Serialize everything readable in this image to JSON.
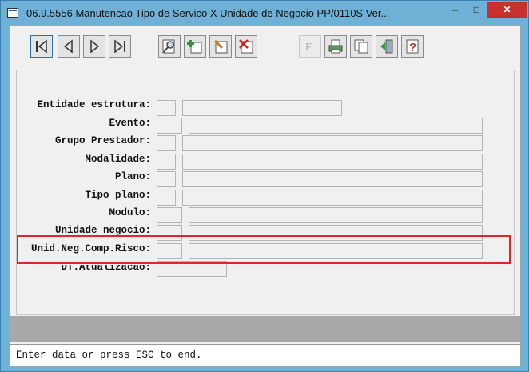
{
  "window": {
    "title": "06.9.5556 Manutencao  Tipo de Servico X Unidade de Negocio PP/0110S Ver..."
  },
  "toolbar": {
    "buttons": [
      {
        "name": "first-record-button",
        "icon": "first-record-icon"
      },
      {
        "name": "previous-record-button",
        "icon": "previous-record-icon"
      },
      {
        "name": "next-record-button",
        "icon": "next-record-icon"
      },
      {
        "name": "last-record-button",
        "icon": "last-record-icon"
      },
      {
        "name": "search-button",
        "icon": "magnifier-icon"
      },
      {
        "name": "add-button",
        "icon": "plus-icon"
      },
      {
        "name": "edit-button",
        "icon": "pencil-icon"
      },
      {
        "name": "delete-button",
        "icon": "delete-x-icon"
      },
      {
        "name": "filter-button",
        "icon": "filter-icon"
      },
      {
        "name": "print-button",
        "icon": "printer-icon"
      },
      {
        "name": "copy-button",
        "icon": "copy-icon"
      },
      {
        "name": "exit-button",
        "icon": "exit-door-icon"
      },
      {
        "name": "help-button",
        "icon": "help-question-icon"
      }
    ]
  },
  "form": {
    "fields": [
      {
        "label": "Entidade estrutura:",
        "value": ""
      },
      {
        "label": "Evento:",
        "value": ""
      },
      {
        "label": "Grupo Prestador:",
        "value": ""
      },
      {
        "label": "Modalidade:",
        "value": ""
      },
      {
        "label": "Plano:",
        "value": ""
      },
      {
        "label": "Tipo plano:",
        "value": ""
      },
      {
        "label": "Modulo:",
        "value": ""
      },
      {
        "label": "Unidade negocio:",
        "value": ""
      },
      {
        "label": "Unid.Neg.Comp.Risco:",
        "value": ""
      },
      {
        "label": "DT.Atualizacao:",
        "value": ""
      }
    ]
  },
  "status": {
    "message": "Enter data or press ESC to end."
  },
  "colors": {
    "titlebar": "#6fb0d6",
    "close_button": "#c7302d",
    "highlight": "#e0262c"
  }
}
